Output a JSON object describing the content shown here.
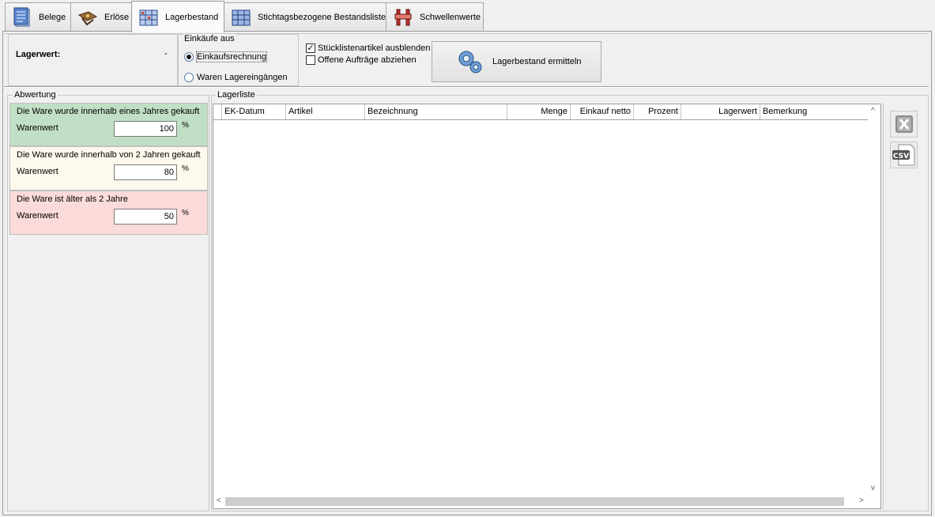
{
  "tabs": [
    {
      "label": "Belege",
      "icon": "document-icon"
    },
    {
      "label": "Erlöse",
      "icon": "money-icon"
    },
    {
      "label": "Lagerbestand",
      "icon": "warehouse-icon",
      "active": true
    },
    {
      "label": "Stichtagsbezogene Bestandsliste",
      "icon": "warehouse-calendar-icon"
    },
    {
      "label": "Schwellenwerte",
      "icon": "threshold-icon"
    }
  ],
  "lagerwert": {
    "label": "Lagerwert:",
    "value": "-"
  },
  "einkaeufe": {
    "legend": "Einkäufe aus",
    "options": [
      {
        "label": "Einkaufsrechnung",
        "checked": true
      },
      {
        "label": "Waren Lagereingängen",
        "checked": false
      }
    ]
  },
  "options": {
    "stueckliste": {
      "label": "Stücklistenartikel ausblenden",
      "checked": true
    },
    "offene": {
      "label": "Offene Aufträge abziehen",
      "checked": false
    }
  },
  "ermitteln_button": {
    "label": "Lagerbestand ermitteln",
    "icon": "gears-icon"
  },
  "abwertung": {
    "legend": "Abwertung",
    "panels": [
      {
        "text": "Die Ware wurde innerhalb eines Jahres gekauft",
        "value_label": "Warenwert",
        "value": "100",
        "unit": "%",
        "color": "#c1dfc4"
      },
      {
        "text": "Die Ware wurde innerhalb von 2 Jahren gekauft",
        "value_label": "Warenwert",
        "value": "80",
        "unit": "%",
        "color": "#fdf9ec"
      },
      {
        "text": "Die Ware ist älter als 2 Jahre",
        "value_label": "Warenwert",
        "value": "50",
        "unit": "%",
        "color": "#fbdada"
      }
    ]
  },
  "lagerliste": {
    "legend": "Lagerliste",
    "columns": [
      "EK-Datum",
      "Artikel",
      "Bezeichnung",
      "Menge",
      "Einkauf netto",
      "Prozent",
      "Lagerwert",
      "Bemerkung"
    ],
    "rows": []
  },
  "export": {
    "excel_icon": "excel-export-icon",
    "csv_icon": "csv-export-icon",
    "csv_text": "CSV"
  },
  "scroll_arrows": {
    "up": "^",
    "down": "v",
    "left": "<",
    "right": ">"
  }
}
